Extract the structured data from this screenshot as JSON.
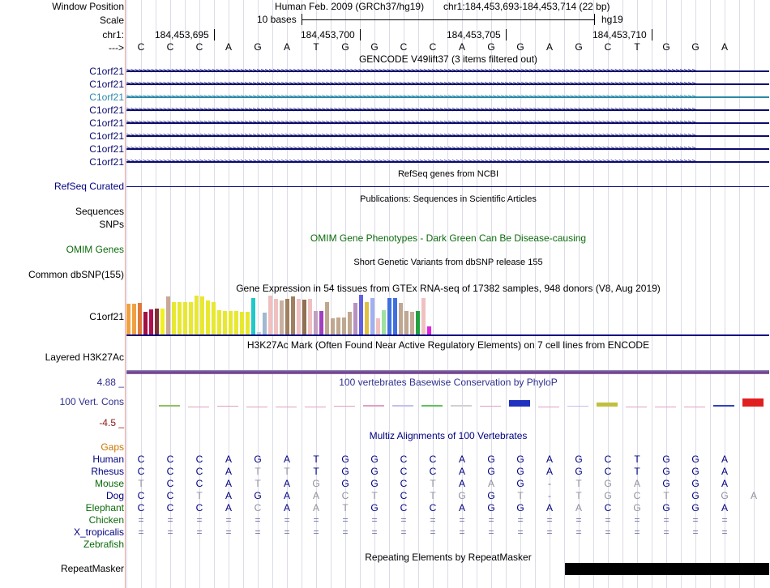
{
  "header": {
    "window_position_label": "Window Position",
    "scale_label": "Scale",
    "chr_label": "chr1:",
    "arrow_label": "--->",
    "assembly": "Human Feb. 2009 (GRCh37/hg19)",
    "position": "chr1:184,453,693-184,453,714 (22 bp)",
    "scale_bases": "10 bases",
    "db": "hg19",
    "coords": [
      "184,453,695",
      "184,453,700",
      "184,453,705",
      "184,453,710"
    ]
  },
  "sequence": [
    "C",
    "C",
    "C",
    "A",
    "G",
    "A",
    "T",
    "G",
    "G",
    "C",
    "C",
    "A",
    "G",
    "G",
    "A",
    "G",
    "C",
    "T",
    "G",
    "G",
    "A"
  ],
  "gencode": {
    "title": "GENCODE V49lift37 (3 items filtered out)",
    "genes": [
      "C1orf21",
      "C1orf21",
      "C1orf21",
      "C1orf21",
      "C1orf21",
      "C1orf21",
      "C1orf21",
      "C1orf21"
    ],
    "highlight_color": "#2a8aa8",
    "gene_color": "#0a0a6e"
  },
  "refseq": {
    "title": "RefSeq genes from NCBI",
    "label": "RefSeq Curated"
  },
  "publications": {
    "title": "Publications: Sequences in Scientific Articles",
    "label": "Sequences"
  },
  "snps": {
    "label": "SNPs"
  },
  "omim": {
    "title": "OMIM Gene Phenotypes - Dark Green Can Be Disease-causing",
    "label": "OMIM Genes",
    "color": "#0d6b0d"
  },
  "dbsnp": {
    "title": "Short Genetic Variants from dbSNP release 155",
    "label": "Common dbSNP(155)"
  },
  "gtex": {
    "title": "Gene Expression in 54 tissues from GTEx RNA-seq of 17382 samples, 948 donors (V8, Aug 2019)",
    "label": "C1orf21",
    "bars": [
      {
        "c": "#f0a040",
        "v": 0.77
      },
      {
        "c": "#f0a040",
        "v": 0.77
      },
      {
        "c": "#e07a3a",
        "v": 0.8
      },
      {
        "c": "#a01040",
        "v": 0.58
      },
      {
        "c": "#b01050",
        "v": 0.63
      },
      {
        "c": "#803030",
        "v": 0.66
      },
      {
        "c": "#f0f020",
        "v": 0.66
      },
      {
        "c": "#c8a898",
        "v": 0.95
      },
      {
        "c": "#e8e830",
        "v": 0.82
      },
      {
        "c": "#e8e830",
        "v": 0.82
      },
      {
        "c": "#e8e830",
        "v": 0.82
      },
      {
        "c": "#e8e830",
        "v": 0.82
      },
      {
        "c": "#e8e830",
        "v": 0.98
      },
      {
        "c": "#e8e830",
        "v": 0.95
      },
      {
        "c": "#e8e830",
        "v": 0.85
      },
      {
        "c": "#e8e830",
        "v": 0.82
      },
      {
        "c": "#e8e830",
        "v": 0.62
      },
      {
        "c": "#e8e830",
        "v": 0.6
      },
      {
        "c": "#e8e830",
        "v": 0.6
      },
      {
        "c": "#e8e830",
        "v": 0.6
      },
      {
        "c": "#e8e830",
        "v": 0.58
      },
      {
        "c": "#e8e830",
        "v": 0.58
      },
      {
        "c": "#20c8c8",
        "v": 0.92
      },
      {
        "c": "#c0d0e0",
        "v": 0.06
      },
      {
        "c": "#a0b8d0",
        "v": 0.55
      },
      {
        "c": "#f0c0c0",
        "v": 0.98
      },
      {
        "c": "#f0c0c0",
        "v": 0.9
      },
      {
        "c": "#c8b0a0",
        "v": 0.85
      },
      {
        "c": "#a08060",
        "v": 0.9
      },
      {
        "c": "#a08060",
        "v": 0.95
      },
      {
        "c": "#f0c0c0",
        "v": 0.9
      },
      {
        "c": "#907050",
        "v": 0.88
      },
      {
        "c": "#f0c0c0",
        "v": 0.9
      },
      {
        "c": "#c0a0c0",
        "v": 0.6
      },
      {
        "c": "#a040c0",
        "v": 0.6
      },
      {
        "c": "#c0a890",
        "v": 0.82
      },
      {
        "c": "#c0a890",
        "v": 0.4
      },
      {
        "c": "#c0a890",
        "v": 0.42
      },
      {
        "c": "#c0a890",
        "v": 0.42
      },
      {
        "c": "#c0a890",
        "v": 0.58
      },
      {
        "c": "#b890c0",
        "v": 0.8
      },
      {
        "c": "#6060e0",
        "v": 1.0
      },
      {
        "c": "#e0c040",
        "v": 0.82
      },
      {
        "c": "#a0b0f0",
        "v": 0.92
      },
      {
        "c": "#f0c0c0",
        "v": 0.4
      },
      {
        "c": "#a0e0a0",
        "v": 0.62
      },
      {
        "c": "#4070e0",
        "v": 0.92
      },
      {
        "c": "#4070e0",
        "v": 0.92
      },
      {
        "c": "#c0a890",
        "v": 0.8
      },
      {
        "c": "#c0a890",
        "v": 0.6
      },
      {
        "c": "#c8a898",
        "v": 0.58
      },
      {
        "c": "#20a040",
        "v": 0.6
      },
      {
        "c": "#f0c0c0",
        "v": 0.92
      },
      {
        "c": "#e020e0",
        "v": 0.2
      }
    ]
  },
  "h3k27ac": {
    "title": "H3K27Ac Mark (Often Found Near Active Regulatory Elements) on 7 cell lines from ENCODE",
    "label": "Layered H3K27Ac"
  },
  "phylop": {
    "title": "100 vertebrates Basewise Conservation by PhyloP",
    "label": "100 Vert. Cons",
    "max": "4.88 _",
    "min": "-4.5 _",
    "color": "#303090"
  },
  "multiz": {
    "title": "Multiz Alignments of 100 Vertebrates",
    "gaps_label": "Gaps",
    "gaps_color": "#c87800",
    "species": [
      {
        "name": "Human",
        "color": "#000080",
        "seq": [
          "C",
          "C",
          "C",
          "A",
          "G",
          "A",
          "T",
          "G",
          "G",
          "C",
          "C",
          "A",
          "G",
          "G",
          "A",
          "G",
          "C",
          "T",
          "G",
          "G",
          "A"
        ]
      },
      {
        "name": "Rhesus",
        "color": "#000080",
        "seq": [
          "C",
          "C",
          "C",
          "A",
          "T",
          "T",
          "T",
          "G",
          "G",
          "C",
          "C",
          "A",
          "G",
          "G",
          "A",
          "G",
          "C",
          "T",
          "G",
          "G",
          "A"
        ]
      },
      {
        "name": "Mouse",
        "color": "#0a6a0a",
        "seq": [
          "T",
          "C",
          "C",
          "A",
          "T",
          "A",
          "G",
          "G",
          "G",
          "C",
          "T",
          "A",
          "A",
          "G",
          "-",
          "T",
          "G",
          "A",
          "G",
          "G",
          "A"
        ]
      },
      {
        "name": "Dog",
        "color": "#000080",
        "seq": [
          "C",
          "C",
          "T",
          "A",
          "G",
          "A",
          "A",
          "C",
          "T",
          "C",
          "T",
          "G",
          "G",
          "T",
          "-",
          "T",
          "G",
          "C",
          "T",
          "G",
          "G",
          "A"
        ]
      },
      {
        "name": "Elephant",
        "color": "#0a6a0a",
        "seq": [
          "C",
          "C",
          "C",
          "A",
          "C",
          "A",
          "A",
          "T",
          "G",
          "C",
          "C",
          "A",
          "G",
          "G",
          "A",
          "A",
          "C",
          "G",
          "G",
          "G",
          "A"
        ]
      },
      {
        "name": "Chicken",
        "color": "#0a6a0a",
        "seq": [
          "=",
          "=",
          "=",
          "=",
          "=",
          "=",
          "=",
          "=",
          "=",
          "=",
          "=",
          "=",
          "=",
          "=",
          "=",
          "=",
          "=",
          "=",
          "=",
          "=",
          "="
        ]
      },
      {
        "name": "X_tropicalis",
        "color": "#000080",
        "seq": [
          "=",
          "=",
          "=",
          "=",
          "=",
          "=",
          "=",
          "=",
          "=",
          "=",
          "=",
          "=",
          "=",
          "=",
          "=",
          "=",
          "=",
          "=",
          "=",
          "=",
          "="
        ]
      },
      {
        "name": "Zebrafish",
        "color": "#0a6a0a",
        "seq": []
      }
    ]
  },
  "repeatmasker": {
    "title": "Repeating Elements by RepeatMasker",
    "label": "RepeatMasker"
  }
}
